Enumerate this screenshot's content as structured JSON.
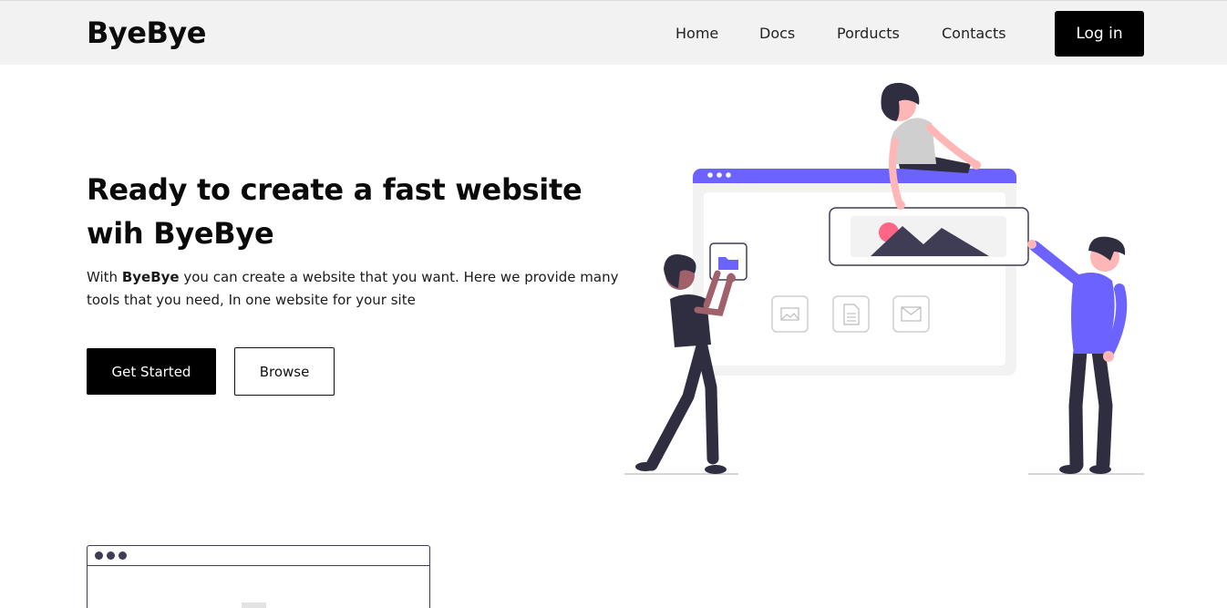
{
  "header": {
    "logo": "ByeBye",
    "nav": [
      "Home",
      "Docs",
      "Porducts",
      "Contacts"
    ],
    "login_label": "Log in"
  },
  "hero": {
    "title": "Ready to create a fast website wih ByeBye",
    "desc_prefix": "With ",
    "desc_brand": "ByeBye",
    "desc_suffix": " you can create a website that you want. Here we provide many tools that you need, In one website for your site",
    "primary_button": "Get Started",
    "secondary_button": "Browse"
  },
  "colors": {
    "accent": "#6c63ff",
    "dark": "#2f2e41",
    "button": "#000000",
    "header_bg": "#f2f2f2"
  },
  "illustration": {
    "icons": [
      "folder-icon",
      "image-icon",
      "document-icon",
      "mail-icon"
    ]
  }
}
